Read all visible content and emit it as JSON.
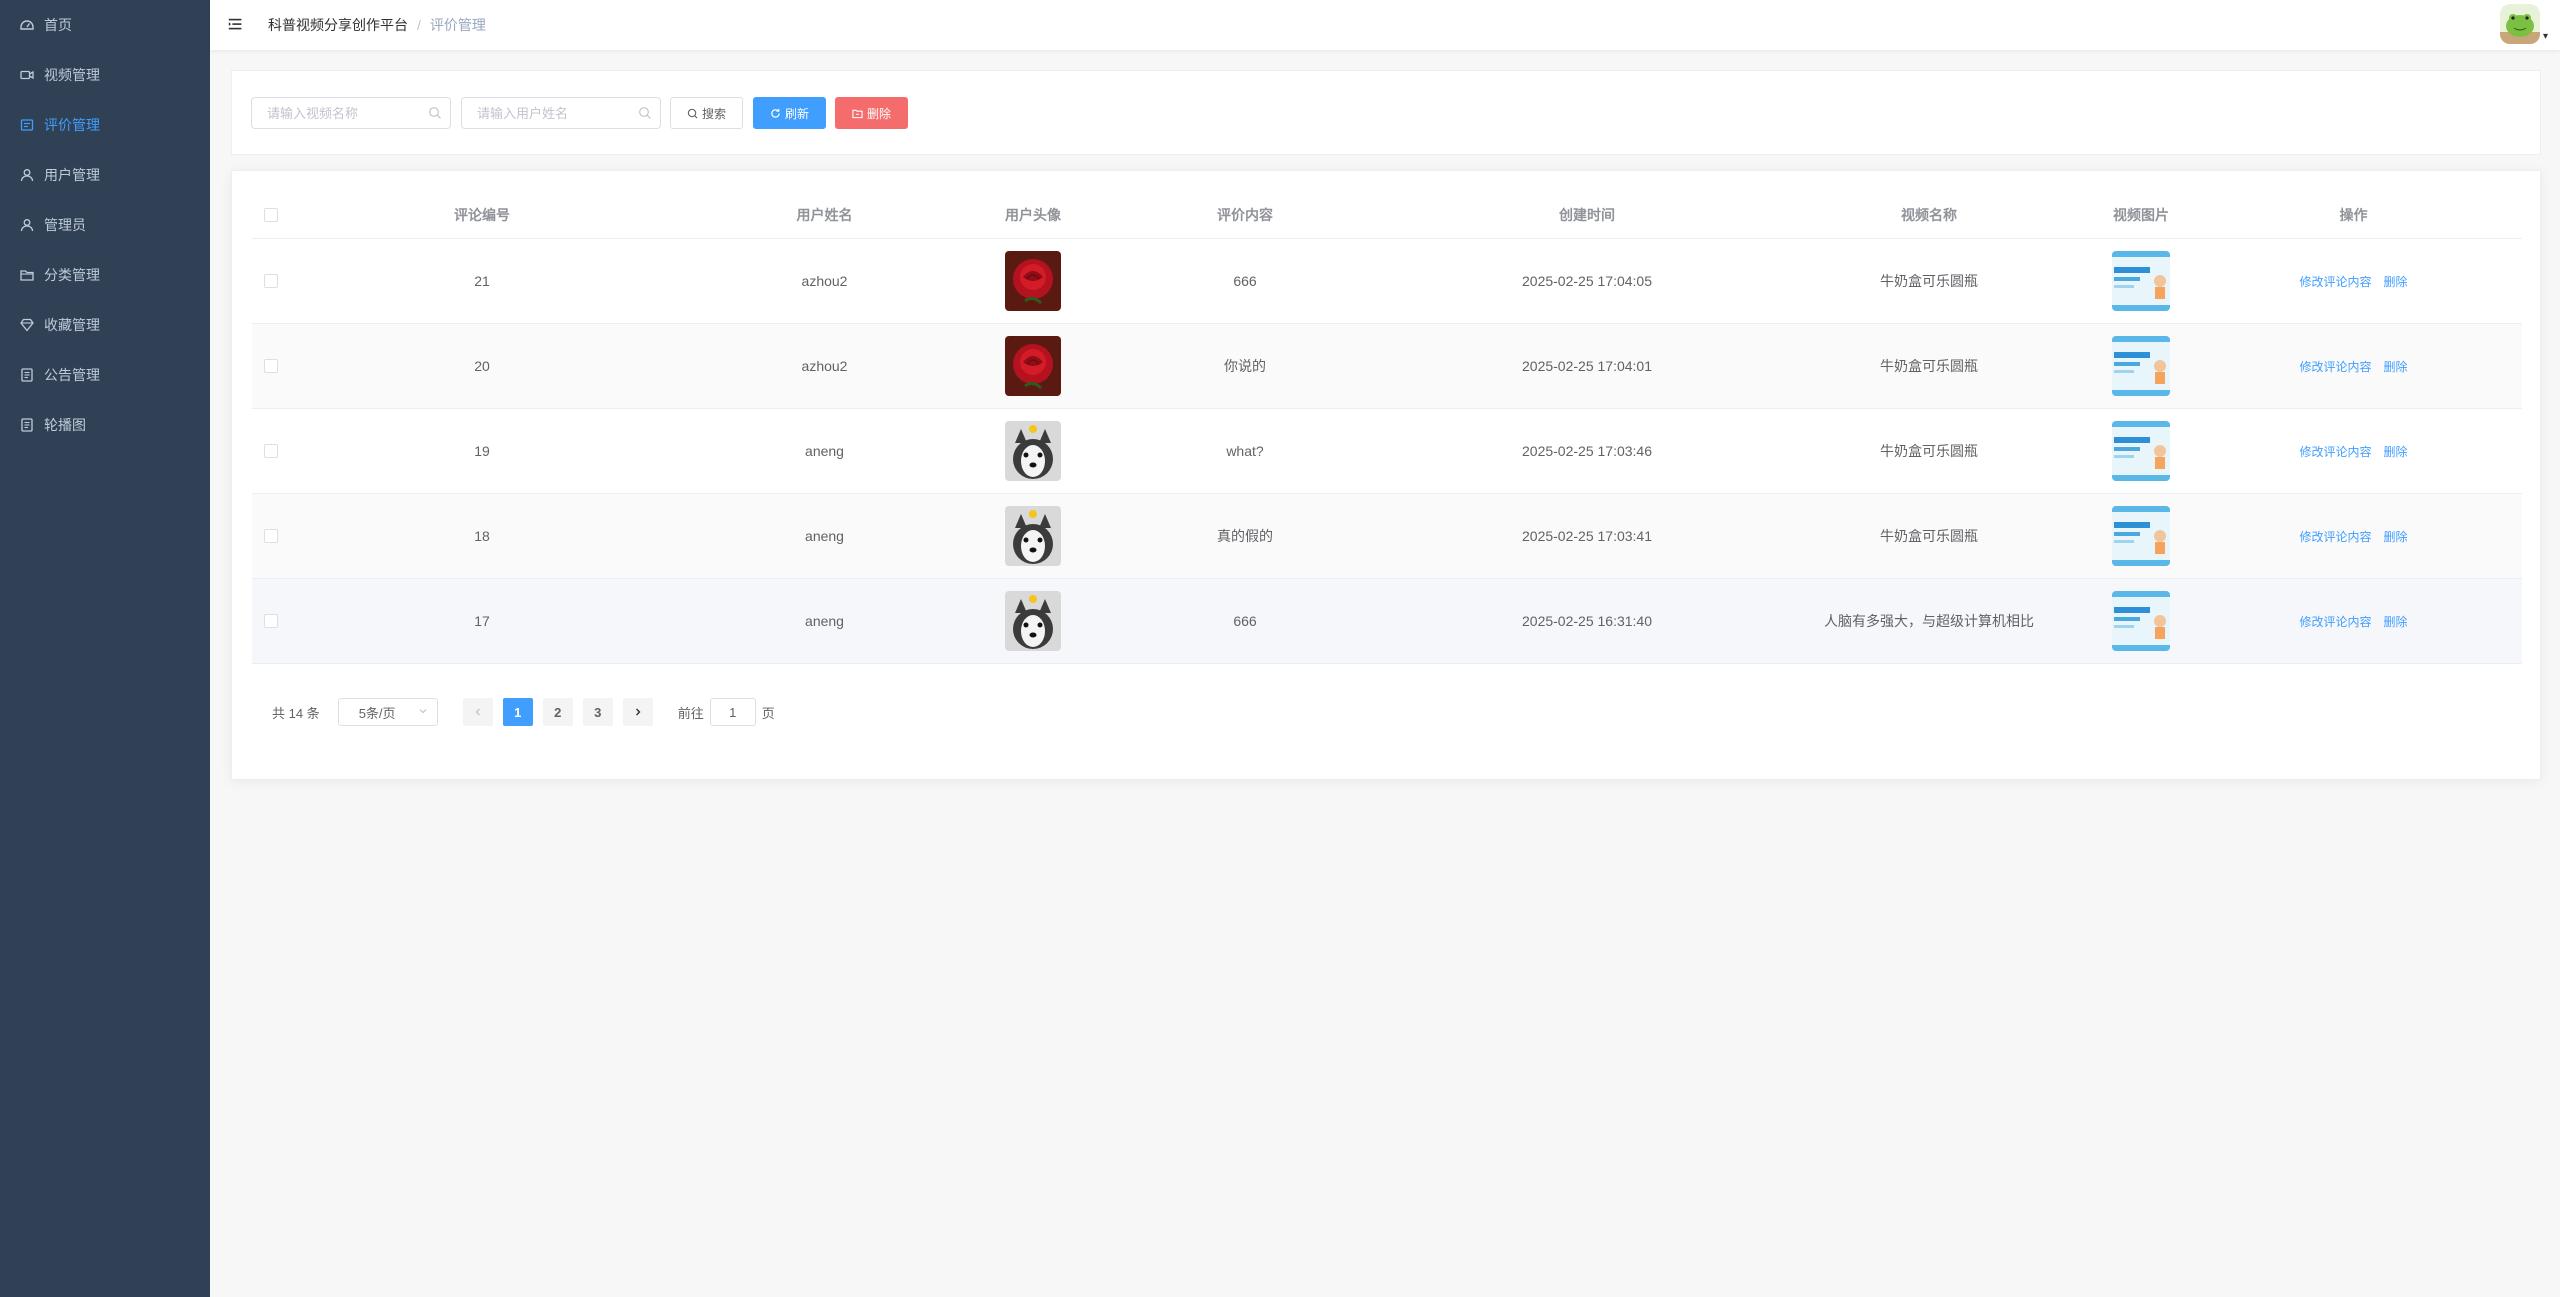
{
  "sidebar": {
    "items": [
      {
        "label": "首页",
        "icon": "dashboard-icon",
        "active": false
      },
      {
        "label": "视频管理",
        "icon": "video-icon",
        "active": false
      },
      {
        "label": "评价管理",
        "icon": "comment-icon",
        "active": true
      },
      {
        "label": "用户管理",
        "icon": "user-icon",
        "active": false
      },
      {
        "label": "管理员",
        "icon": "user-icon",
        "active": false
      },
      {
        "label": "分类管理",
        "icon": "folder-icon",
        "active": false
      },
      {
        "label": "收藏管理",
        "icon": "collect-icon",
        "active": false
      },
      {
        "label": "公告管理",
        "icon": "notice-icon",
        "active": false
      },
      {
        "label": "轮播图",
        "icon": "carousel-icon",
        "active": false
      }
    ]
  },
  "header": {
    "breadcrumb_root": "科普视频分享创作平台",
    "breadcrumb_separator": "/",
    "breadcrumb_current": "评价管理",
    "caret": "▾"
  },
  "search": {
    "video_placeholder": "请输入视频名称",
    "user_placeholder": "请输入用户姓名",
    "search_label": "搜索",
    "refresh_label": "刷新",
    "delete_label": "删除"
  },
  "table": {
    "headers": [
      "评论编号",
      "用户姓名",
      "用户头像",
      "评价内容",
      "创建时间",
      "视频名称",
      "视频图片",
      "操作"
    ],
    "rows": [
      {
        "id": "21",
        "user": "azhou2",
        "avatar": "rose",
        "content": "666",
        "time": "2025-02-25 17:04:05",
        "video": "牛奶盒可乐圆瓶"
      },
      {
        "id": "20",
        "user": "azhou2",
        "avatar": "rose",
        "content": "你说的",
        "time": "2025-02-25 17:04:01",
        "video": "牛奶盒可乐圆瓶"
      },
      {
        "id": "19",
        "user": "aneng",
        "avatar": "husky",
        "content": "what?",
        "time": "2025-02-25 17:03:46",
        "video": "牛奶盒可乐圆瓶"
      },
      {
        "id": "18",
        "user": "aneng",
        "avatar": "husky",
        "content": "真的假的",
        "time": "2025-02-25 17:03:41",
        "video": "牛奶盒可乐圆瓶"
      },
      {
        "id": "17",
        "user": "aneng",
        "avatar": "husky",
        "content": "666",
        "time": "2025-02-25 16:31:40",
        "video": "人脑有多强大，与超级计算机相比"
      }
    ],
    "edit_label": "修改评论内容",
    "delete_label": "删除"
  },
  "pagination": {
    "total_text": "共 14 条",
    "page_size": "5条/页",
    "pages": [
      "1",
      "2",
      "3"
    ],
    "current_page": "1",
    "jump_prefix": "前往",
    "jump_value": "1",
    "jump_suffix": "页"
  },
  "colors": {
    "sidebar_bg": "#304156",
    "accent": "#409eff",
    "danger": "#f56c6c"
  }
}
